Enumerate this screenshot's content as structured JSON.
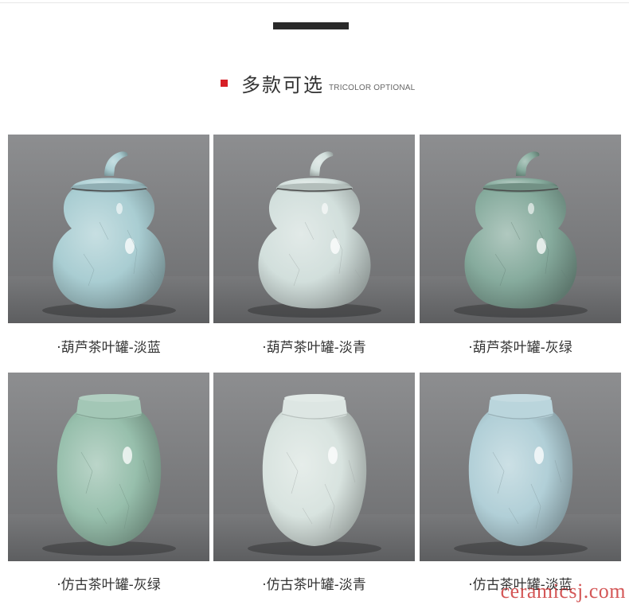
{
  "header": {
    "title": "多款可选",
    "subtitle": "TRICOLOR OPTIONAL",
    "accent_color": "#d61f26"
  },
  "products": [
    {
      "caption": "·葫芦茶叶罐-淡蓝",
      "shape": "gourd",
      "glaze": "#a9cdd2"
    },
    {
      "caption": "·葫芦茶叶罐-淡青",
      "shape": "gourd",
      "glaze": "#d2dfdc"
    },
    {
      "caption": "·葫芦茶叶罐-灰绿",
      "shape": "gourd",
      "glaze": "#86ab9d"
    },
    {
      "caption": "·仿古茶叶罐-灰绿",
      "shape": "jar",
      "glaze": "#97bfac"
    },
    {
      "caption": "·仿古茶叶罐-淡青",
      "shape": "jar",
      "glaze": "#d8e3df"
    },
    {
      "caption": "·仿古茶叶罐-淡蓝",
      "shape": "jar",
      "glaze": "#b1cfd7"
    }
  ],
  "watermark": "ceramicsj.com"
}
